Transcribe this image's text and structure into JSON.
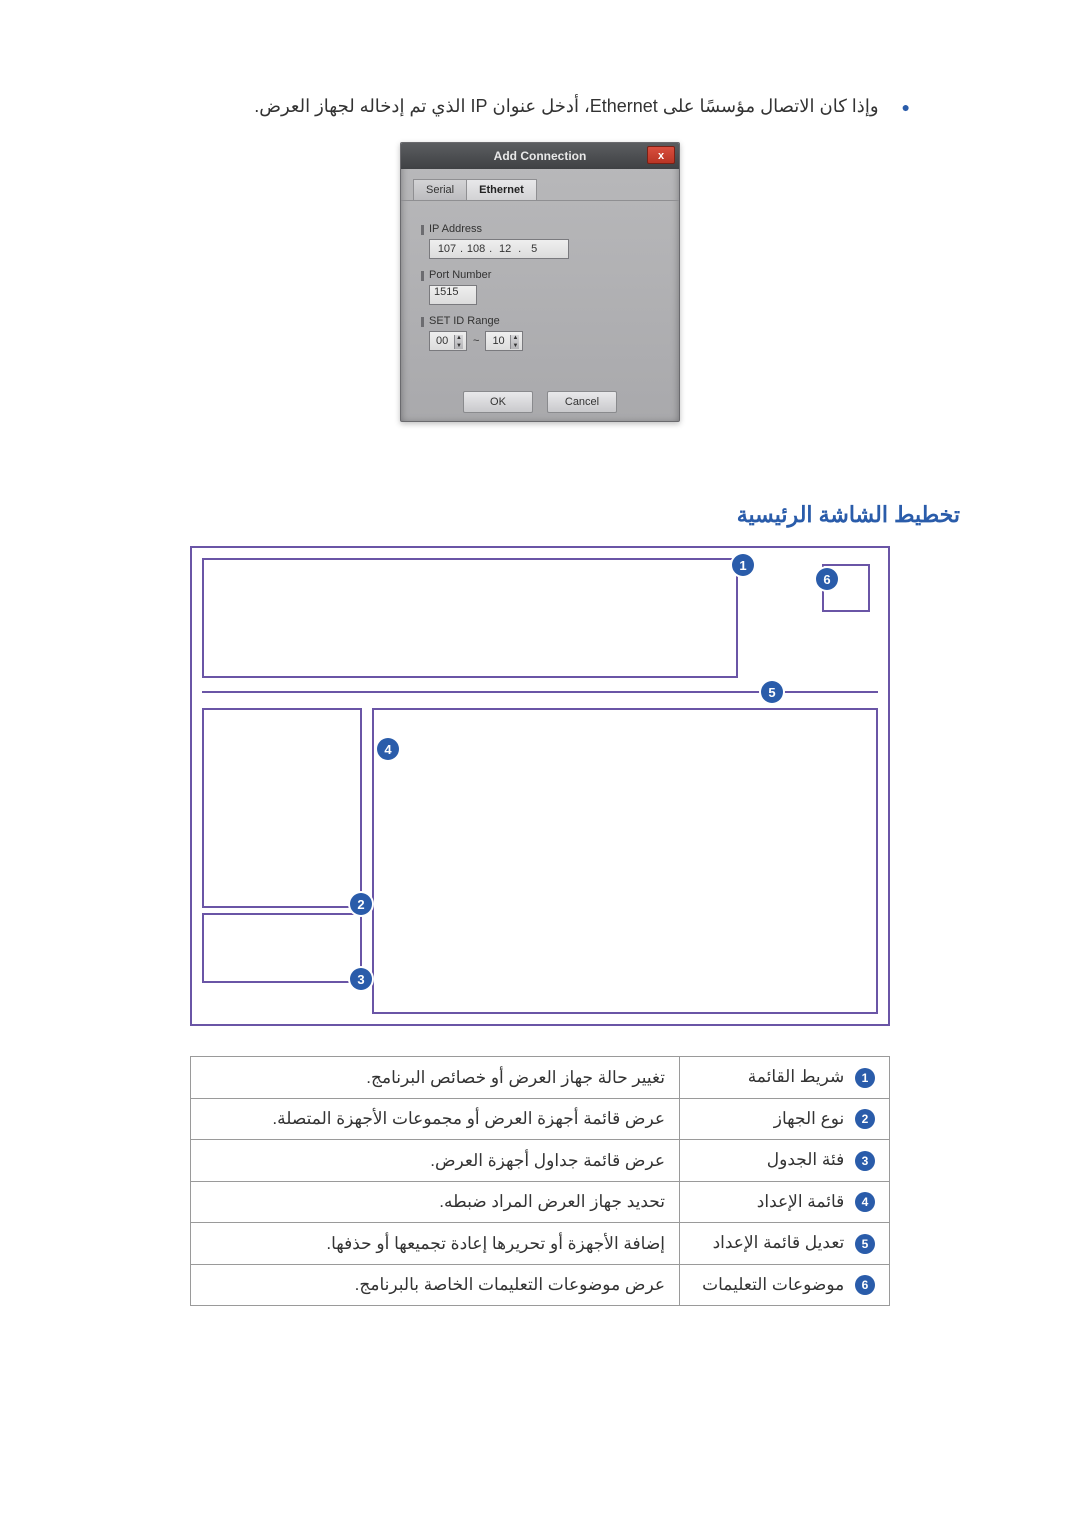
{
  "intro_text": "وإذا كان الاتصال مؤسسًا على Ethernet، أدخل عنوان IP الذي تم إدخاله لجهاز العرض.",
  "dialog": {
    "title": "Add Connection",
    "close_glyph": "x",
    "tabs": {
      "serial": "Serial",
      "ethernet": "Ethernet"
    },
    "ip_label": "IP Address",
    "ip_octets": [
      "107",
      "108",
      "12",
      "5"
    ],
    "port_label": "Port Number",
    "port_value": "1515",
    "range_label": "SET ID Range",
    "range_from": "00",
    "range_sep": "~",
    "range_to": "10",
    "ok_label": "OK",
    "cancel_label": "Cancel"
  },
  "heading": "تخطيط الشاشة الرئيسية",
  "layout_nums": {
    "n1": "1",
    "n2": "2",
    "n3": "3",
    "n4": "4",
    "n5": "5",
    "n6": "6"
  },
  "legend": [
    {
      "num": "1",
      "name": "شريط القائمة",
      "desc": "تغيير حالة جهاز العرض أو خصائص البرنامج."
    },
    {
      "num": "2",
      "name": "نوع الجهاز",
      "desc": "عرض قائمة أجهزة العرض أو مجموعات الأجهزة المتصلة."
    },
    {
      "num": "3",
      "name": "فئة الجدول",
      "desc": "عرض قائمة جداول أجهزة العرض."
    },
    {
      "num": "4",
      "name": "قائمة الإعداد",
      "desc": "تحديد جهاز العرض المراد ضبطه."
    },
    {
      "num": "5",
      "name": "تعديل قائمة الإعداد",
      "desc": "إضافة الأجهزة أو تحريرها إعادة تجميعها أو حذفها."
    },
    {
      "num": "6",
      "name": "موضوعات التعليمات",
      "desc": "عرض موضوعات التعليمات الخاصة بالبرنامج."
    }
  ]
}
